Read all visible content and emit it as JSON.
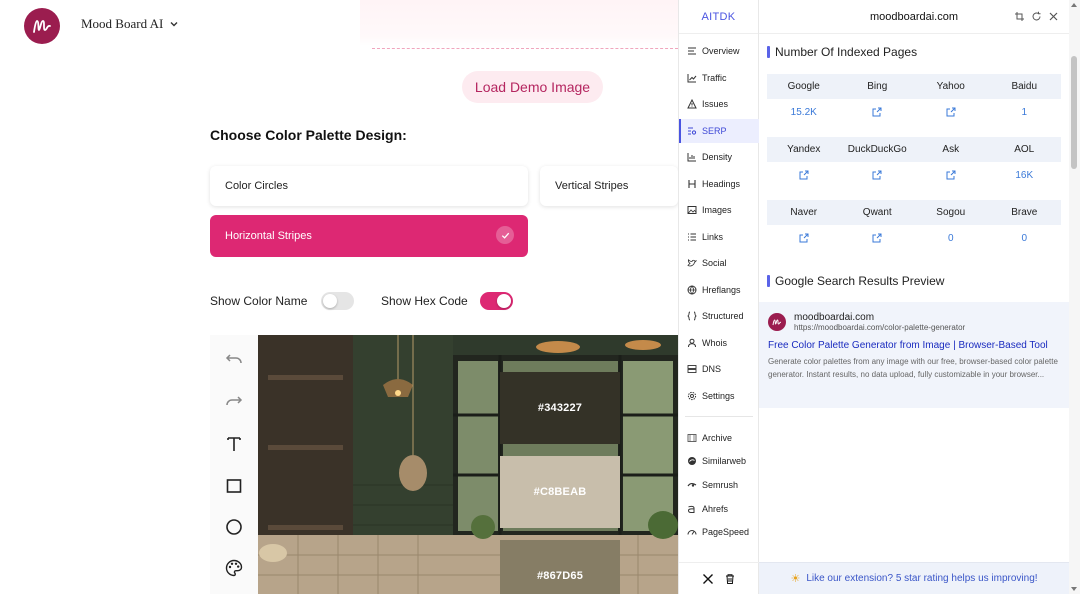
{
  "app": {
    "brand_name": "Mood Board AI",
    "demo_button": "Load Demo Image",
    "palette_title": "Choose Color Palette Design:",
    "options": [
      "Color Circles",
      "Vertical Stripes",
      "Horizontal Stripes"
    ],
    "selected_option": "Horizontal Stripes",
    "show_color_name_label": "Show Color Name",
    "show_color_name": false,
    "show_hex_code_label": "Show Hex Code",
    "show_hex_code": true,
    "tools": [
      "undo-icon",
      "redo-icon",
      "text-icon",
      "rectangle-icon",
      "circle-icon",
      "palette-icon"
    ],
    "swatches": [
      {
        "hex": "#343227",
        "color": "#343227"
      },
      {
        "hex": "#C8BEAB",
        "color": "#C8BEAB"
      },
      {
        "hex": "#867D65",
        "color": "#867D65"
      }
    ],
    "accent": "#DD2873"
  },
  "aitdk": {
    "title": "AITDK",
    "nav": [
      "Overview",
      "Traffic",
      "Issues",
      "SERP",
      "Density",
      "Headings",
      "Images",
      "Links",
      "Social",
      "Hreflangs",
      "Structured",
      "Whois",
      "DNS",
      "Settings"
    ],
    "nav_active": "SERP",
    "tools": [
      "Archive",
      "Similarweb",
      "Semrush",
      "Ahrefs",
      "PageSpeed"
    ],
    "domain": "moodboardai.com",
    "indexed_title": "Number Of Indexed Pages",
    "indexed": [
      {
        "names": [
          "Google",
          "Bing",
          "Yahoo",
          "Baidu"
        ],
        "values": [
          "15.2K",
          "link",
          "link",
          "1"
        ]
      },
      {
        "names": [
          "Yandex",
          "DuckDuckGo",
          "Ask",
          "AOL"
        ],
        "values": [
          "link",
          "link",
          "link",
          "16K"
        ]
      },
      {
        "names": [
          "Naver",
          "Qwant",
          "Sogou",
          "Brave"
        ],
        "values": [
          "link",
          "link",
          "0",
          "0"
        ]
      }
    ],
    "serp_title": "Google Search Results Preview",
    "serp": {
      "site": "moodboardai.com",
      "url": "https://moodboardai.com/color-palette-generator",
      "headline": "Free Color Palette Generator from Image | Browser-Based Tool",
      "description": "Generate color palettes from any image with our free, browser-based color palette generator. Instant results, no data upload, fully customizable in your browser..."
    },
    "footer": "Like our extension? 5 star rating helps us improving!"
  }
}
